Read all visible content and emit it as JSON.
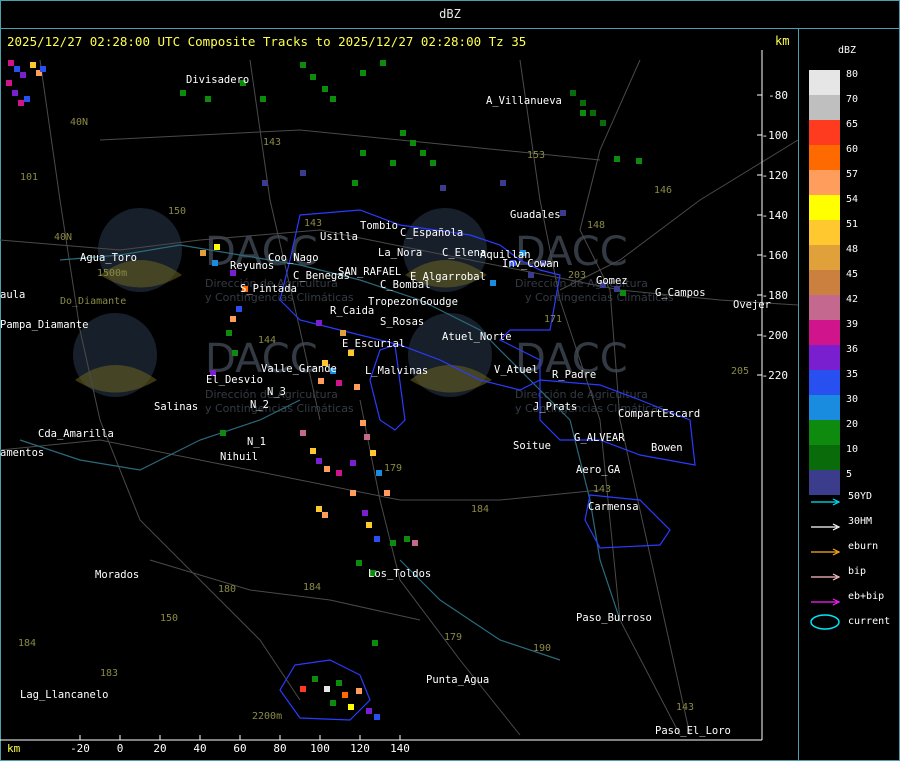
{
  "title": "dBZ",
  "header": "2025/12/27 02:28:00 UTC Composite Tracks to 2025/12/27 02:28:00 Tz 35",
  "km_label": "km",
  "x_axis": {
    "unit": "km",
    "ticks": [
      "-20",
      "0",
      "20",
      "40",
      "60",
      "80",
      "100",
      "120",
      "140"
    ]
  },
  "y_axis": {
    "unit": "km",
    "ticks": [
      "-80",
      "-100",
      "-120",
      "-140",
      "-160",
      "-180",
      "-200",
      "-220"
    ]
  },
  "places": [
    "Divisadero",
    "A_Villanueva",
    "Tombio",
    "Usilla",
    "C_Española",
    "C_Elena",
    "La_Nora",
    "Aquillan",
    "Guadales",
    "Inv_Cowan",
    "Gomez",
    "G_Campos",
    "Ovejer",
    "Reyunos",
    "Coo_Nago",
    "C_Benegas",
    "SAN_RAFAEL",
    "E_Algarrobal",
    "C_Bombal",
    "S_Pintada",
    "Tropezon",
    "Goudge",
    "R_Caida",
    "S_Rosas",
    "Atuel_Norte",
    "E_Escurial",
    "Valle_Grande",
    "L_Malvinas",
    "El_Desvio",
    "V_Atuel",
    "R_Padre",
    "J_Prats",
    "CompartEscard",
    "Salinas",
    "N_2",
    "N_3",
    "N_1",
    "Nihuil",
    "G_ALVEAR",
    "Soitue",
    "Bowen",
    "Aero_GA",
    "Carmensa",
    "Agua_Toro",
    "Pampa_Diamante",
    "Cda_Amarilla",
    "Los_Toldos",
    "Morados",
    "Paso_Burroso",
    "Punta_Agua",
    "Lag_Llancanelo",
    "Paso_El_Loro",
    "aula",
    "amentos",
    "Do_Diamante",
    "1500m",
    "2200m"
  ],
  "roads": [
    "40N",
    "40N",
    "101",
    "143",
    "143",
    "150",
    "153",
    "146",
    "148",
    "203",
    "171",
    "144",
    "179",
    "184",
    "184",
    "180",
    "183",
    "179",
    "190",
    "184",
    "143",
    "205",
    "143",
    "150"
  ],
  "watermark": {
    "logo": "DACC",
    "lines": [
      "Dirección de Agricultura",
      "y Contingencias Climáticas"
    ]
  },
  "legend": {
    "title": "dBZ",
    "scale": [
      {
        "label": "80",
        "color": "#e6e6e6"
      },
      {
        "label": "70",
        "color": "#bfbfbf"
      },
      {
        "label": "65",
        "color": "#ff3b1f"
      },
      {
        "label": "60",
        "color": "#ff6a00"
      },
      {
        "label": "57",
        "color": "#ff9e5c"
      },
      {
        "label": "54",
        "color": "#ffff00"
      },
      {
        "label": "51",
        "color": "#ffc82e"
      },
      {
        "label": "48",
        "color": "#e0a13a"
      },
      {
        "label": "45",
        "color": "#cc8040"
      },
      {
        "label": "42",
        "color": "#c46890"
      },
      {
        "label": "39",
        "color": "#d0148c"
      },
      {
        "label": "36",
        "color": "#7a1fd0"
      },
      {
        "label": "35",
        "color": "#2850f0"
      },
      {
        "label": "30",
        "color": "#1a8ce0"
      },
      {
        "label": "20",
        "color": "#0e8a0e"
      },
      {
        "label": "10",
        "color": "#096b09"
      },
      {
        "label": "5",
        "color": "#3c3c8c"
      }
    ],
    "tracks": [
      {
        "label": "50YD",
        "color": "#00e5ff"
      },
      {
        "label": "30HM",
        "color": "#ffffff"
      },
      {
        "label": "eburn",
        "color": "#ffb020"
      },
      {
        "label": "bip",
        "color": "#ffc0c8"
      },
      {
        "label": "eb+bip",
        "color": "#ff20ff"
      },
      {
        "label": "current",
        "color": "#00e5ff"
      }
    ]
  }
}
